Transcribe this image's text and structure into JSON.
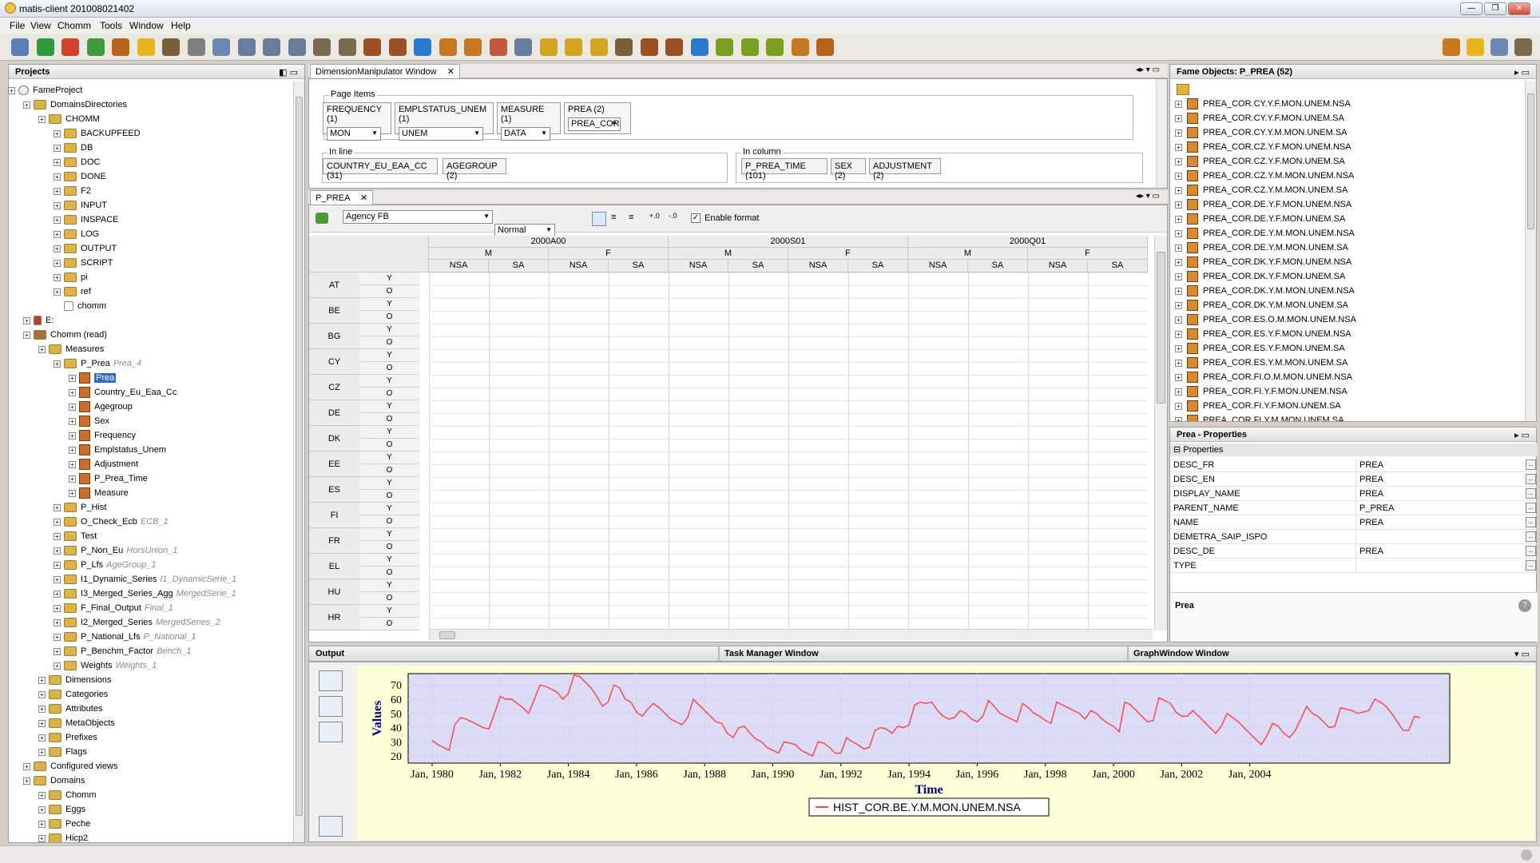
{
  "window": {
    "title": "matis-client 201008021402"
  },
  "menu": [
    "File",
    "View",
    "Chomm",
    "Tools",
    "Window",
    "Help"
  ],
  "toolbar": {
    "icons": [
      "open-icon",
      "forward-icon",
      "back-icon",
      "import-icon",
      "fame-cube-icon",
      "gear-icon",
      "clock-gear-icon",
      "db-icon",
      "clock-icon",
      "table-icon",
      "table-icon",
      "table-icon",
      "gear-icon",
      "gear-icon",
      "cube-icon",
      "cube-icon",
      "globe-icon",
      "cube-icon",
      "cube-icon",
      "clock-icon",
      "table-icon",
      "gear-icon",
      "gear-icon",
      "gear-icon",
      "clock-gear-icon",
      "cube-icon",
      "cube-icon",
      "globe-icon",
      "puzzle-icon",
      "puzzle-icon",
      "puzzle-icon",
      "cube-icon",
      "cube-icon"
    ],
    "right_icons": [
      "cube-icon",
      "user-icon",
      "cube-icon",
      "gear-icon"
    ]
  },
  "projects": {
    "title": "Projects",
    "items": [
      {
        "label": "FameProject",
        "level": 0,
        "icon": "project"
      },
      {
        "label": "DomainsDirectories",
        "level": 1,
        "icon": "folder"
      },
      {
        "label": "CHOMM",
        "level": 2,
        "icon": "folder"
      },
      {
        "label": "BACKUPFEED",
        "level": 3,
        "icon": "folder"
      },
      {
        "label": "DB",
        "level": 3,
        "icon": "folder"
      },
      {
        "label": "DOC",
        "level": 3,
        "icon": "folder"
      },
      {
        "label": "DONE",
        "level": 3,
        "icon": "folder"
      },
      {
        "label": "F2",
        "level": 3,
        "icon": "folder"
      },
      {
        "label": "INPUT",
        "level": 3,
        "icon": "folder"
      },
      {
        "label": "INSPACE",
        "level": 3,
        "icon": "folder"
      },
      {
        "label": "LOG",
        "level": 3,
        "icon": "folder"
      },
      {
        "label": "OUTPUT",
        "level": 3,
        "icon": "folder"
      },
      {
        "label": "SCRIPT",
        "level": 3,
        "icon": "folder"
      },
      {
        "label": "pi",
        "level": 3,
        "icon": "folder"
      },
      {
        "label": "ref",
        "level": 3,
        "icon": "folder"
      },
      {
        "label": "chomm",
        "level": 3,
        "icon": "file"
      },
      {
        "label": "E:",
        "level": 1,
        "icon": "drive"
      },
      {
        "label": "Chomm (read)",
        "level": 1,
        "icon": "db"
      },
      {
        "label": "Measures",
        "level": 2,
        "icon": "folder"
      },
      {
        "label": "P_Prea",
        "level": 3,
        "icon": "folder",
        "note": "Prea_4"
      },
      {
        "label": "Prea",
        "level": 4,
        "icon": "cube",
        "selected": true
      },
      {
        "label": "Country_Eu_Eaa_Cc",
        "level": 4,
        "icon": "cube"
      },
      {
        "label": "Agegroup",
        "level": 4,
        "icon": "cube"
      },
      {
        "label": "Sex",
        "level": 4,
        "icon": "cube"
      },
      {
        "label": "Frequency",
        "level": 4,
        "icon": "cube"
      },
      {
        "label": "Emplstatus_Unem",
        "level": 4,
        "icon": "cube"
      },
      {
        "label": "Adjustment",
        "level": 4,
        "icon": "cube"
      },
      {
        "label": "P_Prea_Time",
        "level": 4,
        "icon": "cube"
      },
      {
        "label": "Measure",
        "level": 4,
        "icon": "cube"
      },
      {
        "label": "P_Hist",
        "level": 3,
        "icon": "folder"
      },
      {
        "label": "O_Check_Ecb",
        "level": 3,
        "icon": "folder",
        "note": "ECB_1"
      },
      {
        "label": "Test",
        "level": 3,
        "icon": "folder"
      },
      {
        "label": "P_Non_Eu",
        "level": 3,
        "icon": "folder",
        "note": "HorsUnion_1"
      },
      {
        "label": "P_Lfs",
        "level": 3,
        "icon": "folder",
        "note": "AgeGroup_1"
      },
      {
        "label": "I1_Dynamic_Series",
        "level": 3,
        "icon": "folder",
        "note": "I1_DynamicSerie_1"
      },
      {
        "label": "I3_Merged_Series_Agg",
        "level": 3,
        "icon": "folder",
        "note": "MergedSerie_1"
      },
      {
        "label": "F_Final_Output",
        "level": 3,
        "icon": "folder",
        "note": "Final_1"
      },
      {
        "label": "I2_Merged_Series",
        "level": 3,
        "icon": "folder",
        "note": "MergedSeries_2"
      },
      {
        "label": "P_National_Lfs",
        "level": 3,
        "icon": "folder",
        "note": "P_National_1"
      },
      {
        "label": "P_Benchm_Factor",
        "level": 3,
        "icon": "folder",
        "note": "Bench_1"
      },
      {
        "label": "Weights",
        "level": 3,
        "icon": "folder",
        "note": "Weights_1"
      },
      {
        "label": "Dimensions",
        "level": 2,
        "icon": "folder"
      },
      {
        "label": "Categories",
        "level": 2,
        "icon": "folder"
      },
      {
        "label": "Attributes",
        "level": 2,
        "icon": "folder"
      },
      {
        "label": "MetaObjects",
        "level": 2,
        "icon": "folder"
      },
      {
        "label": "Prefixes",
        "level": 2,
        "icon": "folder"
      },
      {
        "label": "Flags",
        "level": 2,
        "icon": "folder"
      },
      {
        "label": "Configured views",
        "level": 1,
        "icon": "folder"
      },
      {
        "label": "Domains",
        "level": 1,
        "icon": "folder"
      },
      {
        "label": "Chomm",
        "level": 2,
        "icon": "folder"
      },
      {
        "label": "Eggs",
        "level": 2,
        "icon": "folder"
      },
      {
        "label": "Peche",
        "level": 2,
        "icon": "folder"
      },
      {
        "label": "Hicp2",
        "level": 2,
        "icon": "folder"
      }
    ]
  },
  "dimmanip": {
    "tab": "DimensionManipulator Window",
    "page_items_label": "Page Items",
    "page_items": [
      {
        "label": "FREQUENCY (1)",
        "value": "MON"
      },
      {
        "label": "EMPLSTATUS_UNEM (1)",
        "value": "UNEM"
      },
      {
        "label": "MEASURE (1)",
        "value": "DATA"
      },
      {
        "label": "PREA (2)",
        "value": "PREA_COR"
      }
    ],
    "in_line_label": "In line",
    "in_line": [
      "COUNTRY_EU_EAA_CC (31)",
      "AGEGROUP (2)"
    ],
    "in_column_label": "In column",
    "in_column": [
      "P_PREA_TIME (101)",
      "SEX (2)",
      "ADJUSTMENT (2)"
    ]
  },
  "grid": {
    "tab": "P_PREA",
    "font": "Agency FB",
    "style": "Normal",
    "size": "9",
    "enable_format": "Enable format",
    "periods": [
      "2000A00",
      "2000S01",
      "2000Q01"
    ],
    "sex": [
      "M",
      "F"
    ],
    "adj": [
      "NSA",
      "SA"
    ],
    "rows": [
      "AT",
      "BE",
      "BG",
      "CY",
      "CZ",
      "DE",
      "DK",
      "EE",
      "ES",
      "FI",
      "FR",
      "EL",
      "HU",
      "HR"
    ],
    "yo": [
      "Y",
      "O"
    ]
  },
  "fame_objects": {
    "title": "Fame Objects: P_PREA (52)",
    "items": [
      "PREA_COR.CY.Y.F.MON.UNEM.NSA",
      "PREA_COR.CY.Y.F.MON.UNEM.SA",
      "PREA_COR.CY.Y.M.MON.UNEM.SA",
      "PREA_COR.CZ.Y.F.MON.UNEM.NSA",
      "PREA_COR.CZ.Y.F.MON.UNEM.SA",
      "PREA_COR.CZ.Y.M.MON.UNEM.NSA",
      "PREA_COR.CZ.Y.M.MON.UNEM.SA",
      "PREA_COR.DE.Y.F.MON.UNEM.NSA",
      "PREA_COR.DE.Y.F.MON.UNEM.SA",
      "PREA_COR.DE.Y.M.MON.UNEM.NSA",
      "PREA_COR.DE.Y.M.MON.UNEM.SA",
      "PREA_COR.DK.Y.F.MON.UNEM.NSA",
      "PREA_COR.DK.Y.F.MON.UNEM.SA",
      "PREA_COR.DK.Y.M.MON.UNEM.NSA",
      "PREA_COR.DK.Y.M.MON.UNEM.SA",
      "PREA_COR.ES.O.M.MON.UNEM.NSA",
      "PREA_COR.ES.Y.F.MON.UNEM.NSA",
      "PREA_COR.ES.Y.F.MON.UNEM.SA",
      "PREA_COR.ES.Y.M.MON.UNEM.SA",
      "PREA_COR.FI.O.M.MON.UNEM.NSA",
      "PREA_COR.FI.Y.F.MON.UNEM.NSA",
      "PREA_COR.FI.Y.F.MON.UNEM.SA",
      "PREA_COR.FI.Y.M.MON.UNEM.SA"
    ]
  },
  "properties": {
    "title": "Prea - Properties",
    "section": "Properties",
    "rows": [
      {
        "k": "DESC_FR",
        "v": "PREA"
      },
      {
        "k": "DESC_EN",
        "v": "PREA"
      },
      {
        "k": "DISPLAY_NAME",
        "v": "PREA"
      },
      {
        "k": "PARENT_NAME",
        "v": "P_PREA"
      },
      {
        "k": "NAME",
        "v": "PREA"
      },
      {
        "k": "DEMETRA_SAIP_ISPO",
        "v": ""
      },
      {
        "k": "DESC_DE",
        "v": "PREA"
      },
      {
        "k": "TYPE",
        "v": ""
      }
    ],
    "footer": "Prea"
  },
  "bottom_tabs": {
    "output": "Output",
    "task": "Task Manager Window",
    "graph": "GraphWindow Window"
  },
  "colors": {
    "plot_bg": "#dcdcf6",
    "outer_bg": "#ffffd8",
    "line": "#ff4040",
    "axis_title": "#000080"
  },
  "chart_data": {
    "type": "line",
    "xlabel": "Time",
    "ylabel": "Values",
    "ylim": [
      15,
      78
    ],
    "yticks": [
      20,
      30,
      40,
      50,
      60,
      70
    ],
    "xticks": [
      "Jan, 1980",
      "Jan, 1982",
      "Jan, 1984",
      "Jan, 1986",
      "Jan, 1988",
      "Jan, 1990",
      "Jan, 1992",
      "Jan, 1994",
      "Jan, 1996",
      "Jan, 1998",
      "Jan, 2000",
      "Jan, 2002",
      "Jan, 2004"
    ],
    "x_start_year": 1980,
    "series": [
      {
        "name": "HIST_COR.BE.Y.M.MON.UNEM.NSA",
        "points_per_year": 6,
        "values": [
          31,
          28,
          26,
          24,
          42,
          47,
          46,
          44,
          42,
          40,
          39,
          50,
          62,
          60,
          60,
          57,
          54,
          50,
          60,
          70,
          69,
          67,
          65,
          60,
          64,
          77,
          76,
          72,
          68,
          62,
          55,
          58,
          70,
          68,
          60,
          58,
          51,
          48,
          53,
          57,
          54,
          50,
          46,
          44,
          42,
          47,
          60,
          56,
          52,
          48,
          44,
          43,
          36,
          33,
          40,
          41,
          36,
          32,
          30,
          26,
          24,
          22,
          30,
          29,
          28,
          24,
          22,
          20,
          30,
          29,
          26,
          22,
          22,
          33,
          30,
          28,
          25,
          26,
          38,
          40,
          39,
          36,
          41,
          40,
          42,
          56,
          58,
          57,
          58,
          52,
          48,
          46,
          47,
          52,
          50,
          46,
          44,
          48,
          59,
          55,
          50,
          48,
          46,
          44,
          57,
          54,
          50,
          48,
          45,
          43,
          58,
          56,
          54,
          52,
          50,
          46,
          52,
          50,
          46,
          43,
          41,
          37,
          58,
          56,
          52,
          48,
          44,
          45,
          61,
          59,
          57,
          51,
          48,
          48,
          52,
          48,
          44,
          40,
          36,
          41,
          50,
          47,
          44,
          40,
          36,
          32,
          28,
          34,
          43,
          41,
          36,
          33,
          38,
          46,
          55,
          50,
          48,
          44,
          40,
          41,
          54,
          53,
          52,
          50,
          51,
          52,
          60,
          58,
          55,
          50,
          44,
          38,
          38,
          48,
          47
        ]
      }
    ]
  }
}
